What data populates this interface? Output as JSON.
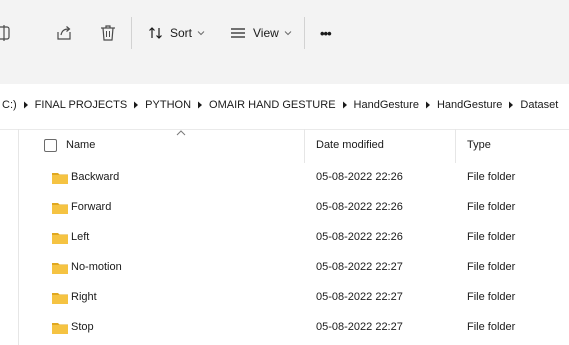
{
  "toolbar": {
    "sort_label": "Sort",
    "view_label": "View",
    "more_label": "•••",
    "icons": [
      "rename-icon",
      "share-icon",
      "delete-icon",
      "sort-icon",
      "view-icon"
    ]
  },
  "breadcrumb": {
    "items": [
      "C:)",
      "FINAL PROJECTS",
      "PYTHON",
      "OMAIR HAND GESTURE",
      "HandGesture",
      "HandGesture",
      "Dataset"
    ]
  },
  "columns": {
    "name": "Name",
    "date": "Date modified",
    "type": "Type"
  },
  "rows": [
    {
      "name": "Backward",
      "date": "05-08-2022 22:26",
      "type": "File folder"
    },
    {
      "name": "Forward",
      "date": "05-08-2022 22:26",
      "type": "File folder"
    },
    {
      "name": "Left",
      "date": "05-08-2022 22:26",
      "type": "File folder"
    },
    {
      "name": "No-motion",
      "date": "05-08-2022 22:27",
      "type": "File folder"
    },
    {
      "name": "Right",
      "date": "05-08-2022 22:27",
      "type": "File folder"
    },
    {
      "name": "Stop",
      "date": "05-08-2022 22:27",
      "type": "File folder"
    }
  ],
  "colors": {
    "toolbar_bg": "#f3f3f3",
    "folder_yellow": "#f5c342",
    "folder_dark": "#e0a820"
  }
}
